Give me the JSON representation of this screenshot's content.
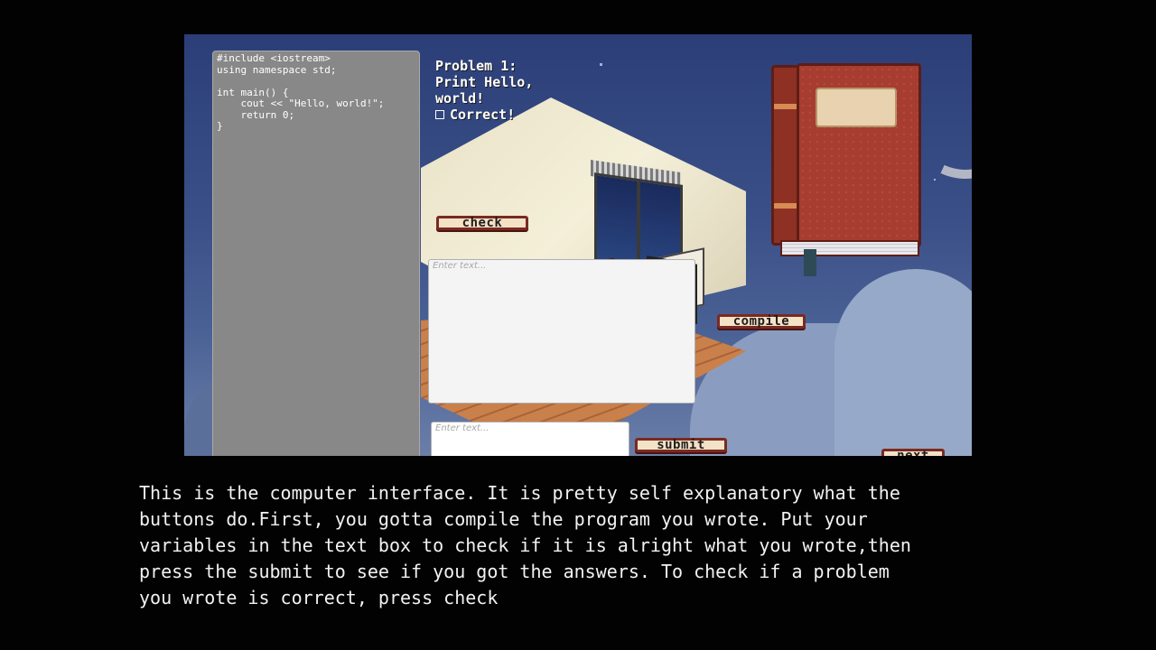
{
  "game": {
    "code_editor": {
      "lines": [
        "#include <iostream>",
        "using namespace std;",
        "",
        "int main() {",
        "    cout << \"Hello, world!\";",
        "    return 0;",
        "}"
      ]
    },
    "problem": {
      "line1": "Problem 1:",
      "line2": "Print Hello,",
      "line3": "world!",
      "status": "Correct!"
    },
    "buttons": {
      "check": "check",
      "compile": "compile",
      "submit": "submit",
      "next": "next"
    },
    "inputs": {
      "output_placeholder": "Enter text...",
      "answer_placeholder": "Enter text..."
    }
  },
  "narration": "This is the computer interface. It is pretty self explanatory what the\nbuttons do.First, you gotta compile the program you wrote. Put your\nvariables in the text box to check if it is alright what you wrote,then\npress the submit to see if you got the answers. To check if a problem\nyou wrote is correct, press check",
  "colors": {
    "button_border": "#7a2a22",
    "button_fill": "#f4e2c6",
    "code_panel": "#888888",
    "sky": "#2b3e78"
  }
}
